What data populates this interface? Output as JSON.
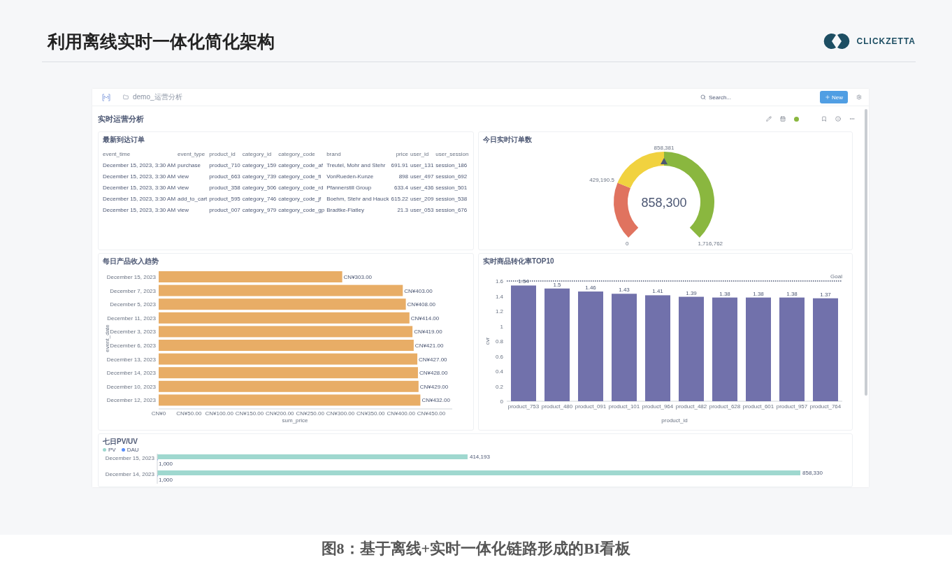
{
  "slide": {
    "title": "利用离线实时一体化简化架构",
    "logo_text": "CLICKZETTA"
  },
  "dashboard": {
    "breadcrumb": "demo_运营分析",
    "search": {
      "placeholder": "Search..."
    },
    "new_button": "New",
    "title": "实时运营分析",
    "orders_table": {
      "title": "最新到达订单",
      "columns": [
        "event_time",
        "event_type",
        "product_id",
        "category_id",
        "category_code",
        "brand",
        "price",
        "user_id",
        "user_session"
      ],
      "rows": [
        [
          "December 15, 2023, 3:30 AM",
          "purchase",
          "product_710",
          "category_159",
          "category_code_af",
          "Treutel, Mohr and Stehr",
          "691.91",
          "user_131",
          "session_186"
        ],
        [
          "December 15, 2023, 3:30 AM",
          "view",
          "product_663",
          "category_739",
          "category_code_fi",
          "VonRueden-Kunze",
          "898",
          "user_497",
          "session_692"
        ],
        [
          "December 15, 2023, 3:30 AM",
          "view",
          "product_358",
          "category_506",
          "category_code_rd",
          "Pfannerstill Group",
          "633.4",
          "user_436",
          "session_501"
        ],
        [
          "December 15, 2023, 3:30 AM",
          "add_to_cart",
          "product_595",
          "category_746",
          "category_code_jf",
          "Boehm, Stehr and Hauck",
          "615.22",
          "user_209",
          "session_538"
        ],
        [
          "December 15, 2023, 3:30 AM",
          "view",
          "product_007",
          "category_979",
          "category_code_gp",
          "Bradtke-Flatley",
          "21.3",
          "user_053",
          "session_676"
        ]
      ]
    },
    "gauge": {
      "title": "今日实时订单数",
      "value": "858,300",
      "ticks": [
        {
          "label": "0",
          "marker": false
        },
        {
          "label": "429,190.5",
          "marker": false
        },
        {
          "label": "858,381",
          "marker": true
        },
        {
          "label": "1,716,762",
          "marker": false
        }
      ],
      "segments": [
        {
          "color": "#e0735f"
        },
        {
          "color": "#f1d23f"
        },
        {
          "color": "#8ab73f"
        }
      ]
    },
    "revenue_chart": {
      "title": "每日产品收入趋势",
      "x_axis_labels": [
        "CN¥0",
        "CN¥50.00",
        "CN¥100.00",
        "CN¥150.00",
        "CN¥200.00",
        "CN¥250.00",
        "CN¥300.00",
        "CN¥350.00",
        "CN¥400.00",
        "CN¥450.00"
      ],
      "chart_data": {
        "type": "bar",
        "orientation": "horizontal",
        "xlabel": "sum_price",
        "ylabel": "event_date",
        "categories": [
          "December 15, 2023",
          "December 7, 2023",
          "December 5, 2023",
          "December 11, 2023",
          "December 3, 2023",
          "December 6, 2023",
          "December 13, 2023",
          "December 14, 2023",
          "December 10, 2023",
          "December 12, 2023"
        ],
        "values": [
          303,
          403,
          408,
          414,
          419,
          421,
          427,
          428,
          429,
          432
        ],
        "value_labels": [
          "CN¥303.00",
          "CN¥403.00",
          "CN¥408.00",
          "CN¥414.00",
          "CN¥419.00",
          "CN¥421.00",
          "CN¥427.00",
          "CN¥428.00",
          "CN¥429.00",
          "CN¥432.00"
        ]
      }
    },
    "conversion_chart": {
      "title": "实时商品转化率TOP10",
      "chart_data": {
        "type": "bar",
        "orientation": "vertical",
        "xlabel": "product_id",
        "ylabel": "cvr",
        "categories": [
          "product_753",
          "product_480",
          "product_091",
          "product_101",
          "product_964",
          "product_482",
          "product_628",
          "product_601",
          "product_957",
          "product_764"
        ],
        "values": [
          1.54,
          1.5,
          1.46,
          1.43,
          1.41,
          1.39,
          1.38,
          1.38,
          1.38,
          1.37
        ],
        "value_labels": [
          "1.54",
          "1.5",
          "1.46",
          "1.43",
          "1.41",
          "1.39",
          "1.38",
          "1.38",
          "1.38",
          "1.37"
        ],
        "ylim": [
          0,
          1.6
        ],
        "yticks": [
          0,
          0.2,
          0.4,
          0.6,
          0.8,
          1,
          1.2,
          1.4,
          1.6
        ],
        "annotations": [
          {
            "text": "Goal"
          }
        ]
      }
    },
    "pv_uv_chart": {
      "title": "七日PV/UV",
      "chart_data": {
        "type": "bar",
        "orientation": "horizontal",
        "stacked": false,
        "data_labels": true,
        "categories": [
          "December 15, 2023",
          "December 14, 2023"
        ],
        "series": [
          {
            "name": "PV",
            "color": "#9fd8cf",
            "values": [
              414193,
              858330
            ],
            "value_labels": [
              "414,193",
              "858,330"
            ]
          },
          {
            "name": "DAU",
            "color": "#5b8ff9",
            "values": [
              1000,
              1000
            ],
            "value_labels": [
              "1,000",
              "1,000"
            ]
          }
        ]
      }
    }
  },
  "caption": "图8：基于离线+实时一体化链路形成的BI看板"
}
